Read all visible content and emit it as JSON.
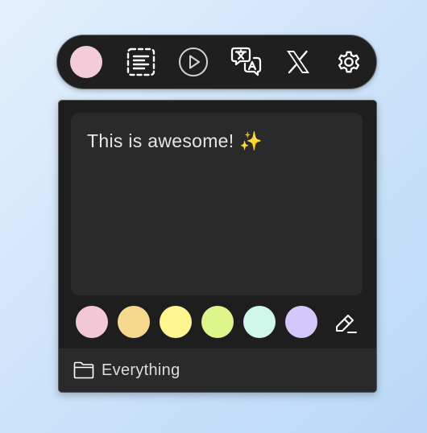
{
  "toolbar": {
    "current_color": "#f3cbd9",
    "icons": [
      "color-picker",
      "select-text-icon",
      "play-icon",
      "translate-icon",
      "x-logo-icon",
      "gear-icon"
    ]
  },
  "note": {
    "text": "This is awesome! ✨"
  },
  "palette": {
    "colors": [
      "#f2c8d7",
      "#f6d88c",
      "#fff58f",
      "#def58a",
      "#cff7ea",
      "#d3c7fb"
    ],
    "edit_icon": "pencil-eraser-icon"
  },
  "folder": {
    "icon": "folder-icon",
    "label": "Everything"
  }
}
